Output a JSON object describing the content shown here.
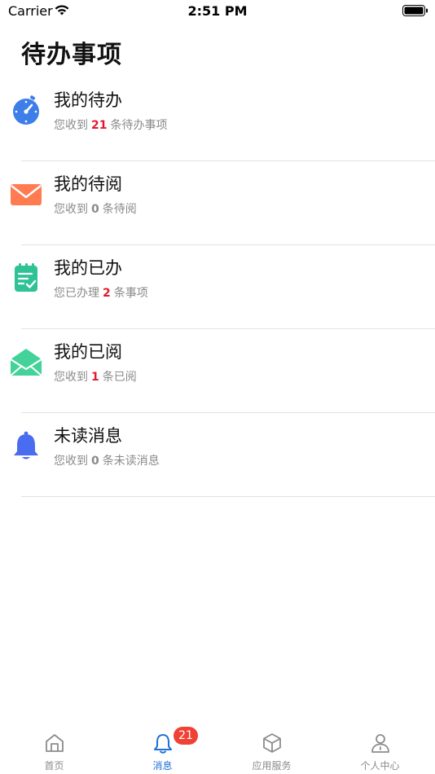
{
  "status_bar": {
    "carrier": "Carrier",
    "time": "2:51 PM"
  },
  "page_title": "待办事项",
  "items": [
    {
      "icon": "timer-icon",
      "title": "我的待办",
      "prefix": "您收到",
      "count": "21",
      "count_color": "red",
      "suffix": "条待办事项"
    },
    {
      "icon": "mail-icon",
      "title": "我的待阅",
      "prefix": "您收到",
      "count": "0",
      "count_color": "gray",
      "suffix": "条待阅"
    },
    {
      "icon": "clipboard-check-icon",
      "title": "我的已办",
      "prefix": "您已办理",
      "count": "2",
      "count_color": "red",
      "suffix": "条事项"
    },
    {
      "icon": "open-mail-icon",
      "title": "我的已阅",
      "prefix": "您收到",
      "count": "1",
      "count_color": "red",
      "suffix": "条已阅"
    },
    {
      "icon": "bell-icon",
      "title": "未读消息",
      "prefix": "您收到",
      "count": "0",
      "count_color": "gray",
      "suffix": "条未读消息"
    }
  ],
  "tab_bar": {
    "active_color": "#1e6fd9",
    "inactive_color": "#8c8c8c",
    "tabs": [
      {
        "label": "首页",
        "icon": "home-icon"
      },
      {
        "label": "消息",
        "icon": "bell-outline-icon",
        "badge": "21",
        "active": true
      },
      {
        "label": "应用服务",
        "icon": "cube-icon"
      },
      {
        "label": "个人中心",
        "icon": "person-icon"
      }
    ]
  }
}
